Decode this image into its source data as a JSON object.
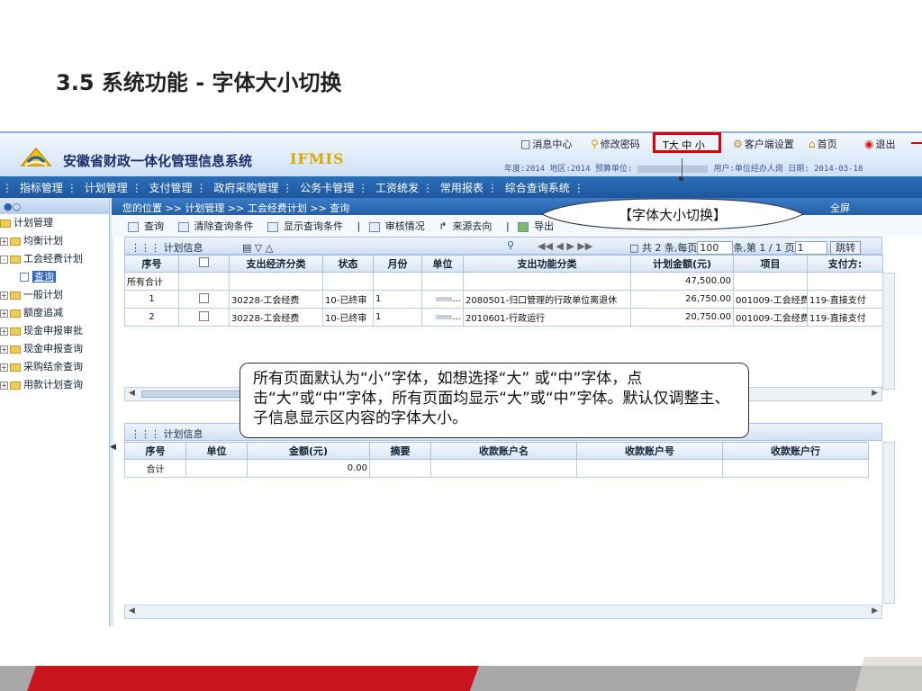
{
  "slide": {
    "title": "3.5  系统功能 - 字体大小切换"
  },
  "header": {
    "system_title": "安徽省财政一体化管理信息系统",
    "brand": "IFMIS",
    "links": {
      "message": "消息中心",
      "password": "修改密码",
      "font_size": "T大 中 小",
      "client": "客户端设置",
      "home": "首页",
      "logout": "退出"
    },
    "info_year": "年度:2014 地区:2014 预算单位:",
    "info_user": "用户:单位经办人岗 日期: 2014-03-18"
  },
  "menu": [
    "指标管理",
    "计划管理",
    "支付管理",
    "政府采购管理",
    "公务卡管理",
    "工资统发",
    "常用报表",
    "综合查询系统"
  ],
  "tree": {
    "root": "计划管理",
    "items": [
      "均衡计划",
      "工会经费计划",
      "查询",
      "一般计划",
      "额度追减",
      "现金申报审批",
      "现金申报查询",
      "采购结余查询",
      "用款计划查询"
    ]
  },
  "breadcrumb": "您的位置 >> 计划管理 >> 工会经费计划 >> 查询",
  "fullscreen": "全屏",
  "toolbar": [
    "查询",
    "清除查询条件",
    "显示查询条件",
    "审核情况",
    "来源去向",
    "导出"
  ],
  "upper": {
    "section": "计划信息",
    "pager": "共 2 条,每页",
    "page_size": "100",
    "pager_tail": "条,第 1 / 1 页",
    "page_input": "1",
    "jump": "跳转",
    "columns": [
      "序号",
      "",
      "支出经济分类",
      "状态",
      "月份",
      "单位",
      "支出功能分类",
      "计划金额(元)",
      "项目",
      "支付方:"
    ],
    "total_label": "所有合计",
    "total_amount": "47,500.00",
    "rows": [
      {
        "no": "1",
        "econ": "30228-工会经费",
        "status": "10-已终审",
        "month": "1",
        "unit": "...",
        "func": "2080501-归口管理的行政单位离退休",
        "amount": "26,750.00",
        "project": "001009-工会经费",
        "pay": "119-直接支付"
      },
      {
        "no": "2",
        "econ": "30228-工会经费",
        "status": "10-已终审",
        "month": "1",
        "unit": "...",
        "func": "2010601-行政运行",
        "amount": "20,750.00",
        "project": "001009-工会经费",
        "pay": "119-直接支付"
      }
    ]
  },
  "lower": {
    "section": "计划信息",
    "columns": [
      "序号",
      "单位",
      "金额(元)",
      "摘要",
      "收款账户名",
      "收款账户号",
      "收款账户行"
    ],
    "total_label": "合计",
    "total_amount": "0.00"
  },
  "callouts": {
    "top": "【字体大小切换】",
    "text": "所有页面默认为“小”字体，如想选择“大” 或“中”字体，点击“大”或“中”字体，所有页面均显示“大”或“中”字体。默认仅调整主、子信息显示区内容的字体大小。"
  },
  "colors": {
    "accent_red": "#e00000",
    "menu_blue": "#1d569e",
    "footer_red": "#c8141c",
    "footer_gray": "#a8a8a8"
  }
}
